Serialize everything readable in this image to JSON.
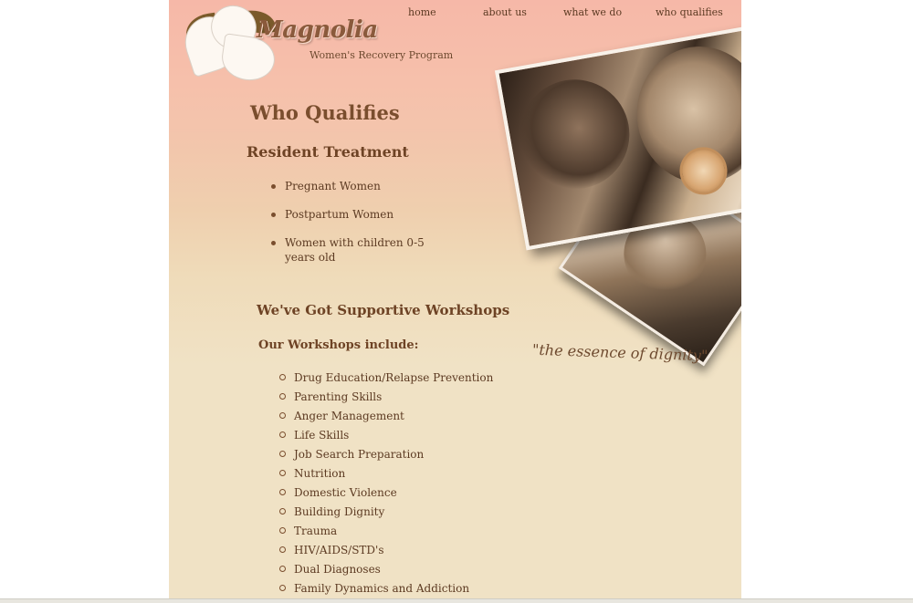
{
  "brand": {
    "name": "Magnolia",
    "subtitle": "Women's Recovery Program",
    "tagline": "\"the essence of dignity\""
  },
  "nav": {
    "items": [
      {
        "label": "home"
      },
      {
        "label": "about us"
      },
      {
        "label": "what we do"
      },
      {
        "label": "who qualifies"
      }
    ]
  },
  "page": {
    "title": "Who Qualifies"
  },
  "resident": {
    "heading": "Resident Treatment",
    "items": [
      {
        "label": "Pregnant Women"
      },
      {
        "label": "Postpartum Women"
      },
      {
        "label": "Women with children 0-5 years old"
      }
    ]
  },
  "workshops": {
    "heading": "We've Got Supportive Workshops",
    "subheading": "Our Workshops include:",
    "items": [
      {
        "label": "Drug Education/Relapse Prevention"
      },
      {
        "label": "Parenting Skills"
      },
      {
        "label": "Anger Management"
      },
      {
        "label": "Life Skills"
      },
      {
        "label": "Job Search Preparation"
      },
      {
        "label": "Nutrition"
      },
      {
        "label": "Domestic Violence"
      },
      {
        "label": "Building Dignity"
      },
      {
        "label": "Trauma"
      },
      {
        "label": "HIV/AIDS/STD's"
      },
      {
        "label": "Dual Diagnoses"
      },
      {
        "label": "Family Dynamics and Addiction"
      }
    ]
  },
  "colors": {
    "header_pink": "#f6b8a8",
    "body_cream": "#f0e2c5",
    "text_brown": "#5c3a22",
    "heading_brown": "#7a4e2e",
    "leaf_olive": "#7a5a2a"
  }
}
